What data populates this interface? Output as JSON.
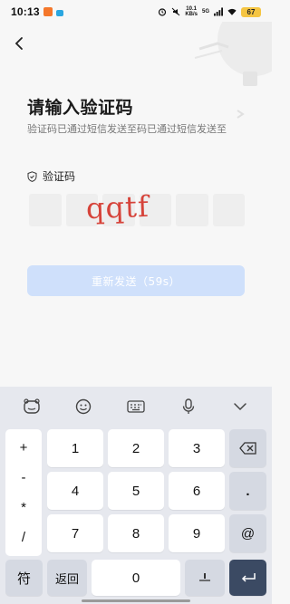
{
  "status_bar": {
    "time": "10:13",
    "net_speed_value": "10.1",
    "net_speed_unit": "KB/s",
    "network": "5G",
    "battery": "67"
  },
  "header": {
    "title": "请输入验证码",
    "subtitle": "验证码已通过短信发送至码已通过短信发送至"
  },
  "code": {
    "label": "验证码",
    "captcha_text": "qqtf",
    "captcha_color": "#d6433a"
  },
  "resend": {
    "label": "重新发送（59s）",
    "color": "#cfe0fb"
  },
  "keyboard": {
    "symbols": [
      "+",
      "-",
      "*",
      "/"
    ],
    "digits": [
      "1",
      "2",
      "3",
      "4",
      "5",
      "6",
      "7",
      "8",
      "9"
    ],
    "dot": ".",
    "at": "@",
    "zero": "0",
    "sym_label": "符",
    "back_label": "返回",
    "enter_color": "#3b4a63"
  }
}
